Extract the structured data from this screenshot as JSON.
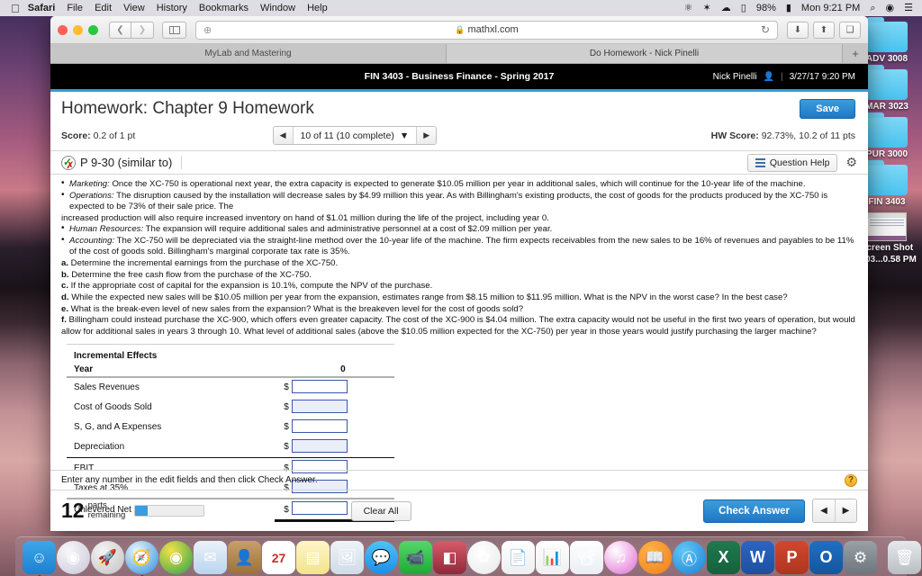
{
  "menubar": {
    "apple": "",
    "items": [
      {
        "label": "Safari",
        "bold": true
      },
      {
        "label": "File",
        "bold": false
      },
      {
        "label": "Edit",
        "bold": false
      },
      {
        "label": "View",
        "bold": false
      },
      {
        "label": "History",
        "bold": false
      },
      {
        "label": "Bookmarks",
        "bold": false
      },
      {
        "label": "Window",
        "bold": false
      },
      {
        "label": "Help",
        "bold": false
      }
    ],
    "status": {
      "vpn_icon": "⚥",
      "bluetooth_icon": "✲",
      "wifi_icon": "⌁",
      "airplay_icon": "▭",
      "battery_percent": "98%",
      "battery_icon": "▰",
      "clock": "Mon 9:21 PM",
      "search_icon": "⌕",
      "siri_icon": "◉",
      "notification_icon": "☰"
    }
  },
  "desktop": {
    "icons": [
      {
        "label": "ADV 3008",
        "type": "folder"
      },
      {
        "label": "MAR 3023",
        "type": "folder"
      },
      {
        "label": "PUR 3000",
        "type": "folder"
      },
      {
        "label": "FIN 3403",
        "type": "folder"
      },
      {
        "label": "Screen Shot",
        "label2": "7-03...0.58 PM",
        "type": "screenshot"
      }
    ]
  },
  "browser": {
    "url": "mathxl.com",
    "lock_icon": "🔒",
    "reload_icon": "↻",
    "back_icon": "❮",
    "forward_icon": "❯",
    "plus_icon": "⊕",
    "downloads_icon": "⬇",
    "share_icon": "⬆",
    "tabs_icon": "❐",
    "new_tab_icon": "+",
    "tabs": [
      {
        "label": "MyLab and Mastering",
        "active": false
      },
      {
        "label": "Do Homework - Nick Pinelli",
        "active": true
      }
    ]
  },
  "course": {
    "title": "FIN 3403 - Business Finance - Spring 2017",
    "user": "Nick Pinelli",
    "user_icon": "👤",
    "separator": "|",
    "timestamp": "3/27/17 9:20 PM"
  },
  "homework": {
    "title": "Homework: Chapter 9 Homework",
    "save_label": "Save",
    "score_label": "Score:",
    "score_value": "0.2 of 1 pt",
    "nav_prev_icon": "◀",
    "nav_next_icon": "▶",
    "nav_select": "10 of 11 (10 complete)",
    "nav_caret": "▼",
    "hw_score_label": "HW Score:",
    "hw_score_value": "92.73%, 10.2 of 11 pts"
  },
  "question": {
    "label": "P 9-30 (similar to)",
    "check_glyph": "✓",
    "x_glyph": "✗",
    "help_label": "Question Help",
    "gear_icon": "⚙",
    "paragraphs": [
      {
        "kind": "bullet",
        "lead": "Marketing:",
        "text": " Once the XC-750 is operational next year, the extra capacity is expected to generate $10.05 million per year in additional sales, which will continue for the 10-year life of the machine."
      },
      {
        "kind": "bullet",
        "lead": "Operations:",
        "text": " The disruption caused by the installation will decrease sales by $4.99 million this year. As with Billingham's existing products, the cost of goods for the products produced by the XC-750 is expected to be 73% of their sale price. The"
      },
      {
        "kind": "plain",
        "lead": "",
        "text": "increased production will also require increased inventory on hand of $1.01 million during the life of the project, including year 0."
      },
      {
        "kind": "bullet",
        "lead": "Human Resources:",
        "text": " The expansion will require additional sales and administrative personnel at a cost of $2.09 million per year."
      },
      {
        "kind": "bullet",
        "lead": "Accounting:",
        "text": " The XC-750 will be depreciated via the straight-line method over the 10-year life of the machine. The firm expects receivables from the new sales to be 16% of revenues and payables to be 11% of the cost of goods sold. Billingham's marginal corporate tax rate is 35%."
      },
      {
        "kind": "item",
        "lead": "a.",
        "text": " Determine the incremental earnings from the purchase of the XC-750."
      },
      {
        "kind": "item",
        "lead": "b.",
        "text": " Determine the free cash flow from the purchase of the XC-750."
      },
      {
        "kind": "item",
        "lead": "c.",
        "text": " If the appropriate cost of capital for the expansion is 10.1%, compute the NPV of the purchase."
      },
      {
        "kind": "item",
        "lead": "d.",
        "text": " While the expected new sales will be $10.05 million per year from the expansion, estimates range from $8.15 million to  $11.95 million. What is the NPV in the worst case? In the best case?"
      },
      {
        "kind": "item",
        "lead": "e.",
        "text": " What is the break-even level of new sales from the expansion? What is the breakeven level for the cost of goods sold?"
      },
      {
        "kind": "item",
        "lead": "f.",
        "text": " Billingham could instead purchase the XC-900, which offers even greater capacity. The cost of the XC-900 is $4.04 million. The extra capacity would not be useful in the first two years of operation, but would allow for additional sales in years 3 through 10. What level of additional sales (above the $10.05 million expected for the XC-750) per year in those years would justify purchasing the larger machine?"
      }
    ]
  },
  "table": {
    "caption": "Incremental Effects",
    "year_label": "Year",
    "year_value": "0",
    "dollar": "$",
    "rows": [
      {
        "label": "Sales Revenues",
        "value": "",
        "shaded": false
      },
      {
        "label": "Cost of Goods Sold",
        "value": "",
        "shaded": true
      },
      {
        "label": "S, G, and A Expenses",
        "value": "",
        "shaded": false
      },
      {
        "label": "Depreciation",
        "value": "",
        "shaded": true
      },
      {
        "label": "EBIT",
        "value": "",
        "shaded": false
      },
      {
        "label": "Taxes at 35%",
        "value": "",
        "shaded": true
      },
      {
        "label": "Unlevered Net Income",
        "value": "",
        "shaded": false
      }
    ]
  },
  "footer": {
    "instruction": "Enter any number in the edit fields and then click Check Answer.",
    "help_glyph": "?",
    "parts_count": "12",
    "parts_line1": "parts",
    "parts_line2": "remaining",
    "progress_percent": 18,
    "clear_all_label": "Clear All",
    "check_answer_label": "Check Answer",
    "prev_icon": "◀",
    "next_icon": "▶"
  },
  "dock": {
    "items": [
      {
        "name": "finder-icon",
        "glyph": "☺",
        "bg": "linear-gradient(180deg,#3ea6e8,#1d7fd0)",
        "running": true
      },
      {
        "name": "siri-icon",
        "glyph": "◉",
        "bg": "radial-gradient(circle at 35% 30%, #f7f7fa, #c9c6d8)",
        "round": true,
        "running": false
      },
      {
        "name": "launchpad-icon",
        "glyph": "🚀",
        "bg": "radial-gradient(circle at 35% 30%, #f3f3f3, #c2c2c2)",
        "round": true,
        "running": false
      },
      {
        "name": "safari-icon",
        "glyph": "🧭",
        "bg": "radial-gradient(circle at 35% 30%, #eaf6ff, #2d8fd8)",
        "round": true,
        "running": true
      },
      {
        "name": "chrome-icon",
        "glyph": "◉",
        "bg": "radial-gradient(circle at 35% 30%, #f4e04b, #2aa34a)",
        "round": true,
        "running": false
      },
      {
        "name": "mail-icon",
        "glyph": "✉",
        "bg": "linear-gradient(180deg,#eaf2fb,#b9d4ee)",
        "running": false
      },
      {
        "name": "contacts-icon",
        "glyph": "👤",
        "bg": "linear-gradient(180deg,#c8a06a,#9a6f3c)",
        "running": false
      },
      {
        "name": "calendar-icon",
        "glyph": "27",
        "bg": "#ffffff",
        "running": false
      },
      {
        "name": "notes-icon",
        "glyph": "▤",
        "bg": "linear-gradient(180deg,#fff6c9,#f3e38a)",
        "running": false
      },
      {
        "name": "photos-preview-icon",
        "glyph": "🖼",
        "bg": "linear-gradient(180deg,#eef3f8,#cfdbe6)",
        "running": false
      },
      {
        "name": "messages-icon",
        "glyph": "💬",
        "bg": "linear-gradient(180deg,#4fc3f7,#1e8ee8)",
        "round": true,
        "running": false
      },
      {
        "name": "facetime-icon",
        "glyph": "📹",
        "bg": "linear-gradient(180deg,#55d86a,#1fa838)",
        "running": false
      },
      {
        "name": "photobooth-icon",
        "glyph": "◧",
        "bg": "linear-gradient(180deg,#d85a6a,#8e2a3a)",
        "running": false
      },
      {
        "name": "photos-icon",
        "glyph": "✿",
        "bg": "radial-gradient(circle at 40% 35%, #ffffff, #e8e8e8)",
        "round": true,
        "running": false
      },
      {
        "name": "pages-icon",
        "glyph": "📄",
        "bg": "linear-gradient(180deg,#ffffff,#eeeeee)",
        "running": false
      },
      {
        "name": "numbers-icon",
        "glyph": "📊",
        "bg": "linear-gradient(180deg,#ffffff,#f0f0f0)",
        "running": false
      },
      {
        "name": "keynote-icon",
        "glyph": "📽",
        "bg": "linear-gradient(180deg,#ffffff,#e9eef4)",
        "running": false
      },
      {
        "name": "itunes-icon",
        "glyph": "♫",
        "bg": "radial-gradient(circle at 35% 30%, #ffffff, #e06ad4)",
        "round": true,
        "running": false
      },
      {
        "name": "ibooks-icon",
        "glyph": "📖",
        "bg": "radial-gradient(circle at 35% 30%, #ffb347, #ef7d1a)",
        "round": true,
        "running": false
      },
      {
        "name": "appstore-icon",
        "glyph": "Ⓐ",
        "bg": "radial-gradient(circle at 35% 30%, #62c8f5, #1b7fd4)",
        "round": true,
        "running": false
      },
      {
        "name": "excel-icon",
        "glyph": "X",
        "bg": "linear-gradient(180deg,#1f7a4d,#14613c)",
        "running": false
      },
      {
        "name": "word-icon",
        "glyph": "W",
        "bg": "linear-gradient(180deg,#2b66c4,#1d4f9e)",
        "running": false
      },
      {
        "name": "powerpoint-icon",
        "glyph": "P",
        "bg": "linear-gradient(180deg,#d2472e,#ad3520)",
        "running": false
      },
      {
        "name": "outlook-icon",
        "glyph": "O",
        "bg": "linear-gradient(180deg,#1f6fc4,#14569c)",
        "running": false
      },
      {
        "name": "system-preferences-icon",
        "glyph": "⚙",
        "bg": "linear-gradient(180deg,#9aa0a6,#6e757c)",
        "running": false
      }
    ],
    "trash": {
      "name": "trash-icon",
      "glyph": "🗑"
    }
  }
}
